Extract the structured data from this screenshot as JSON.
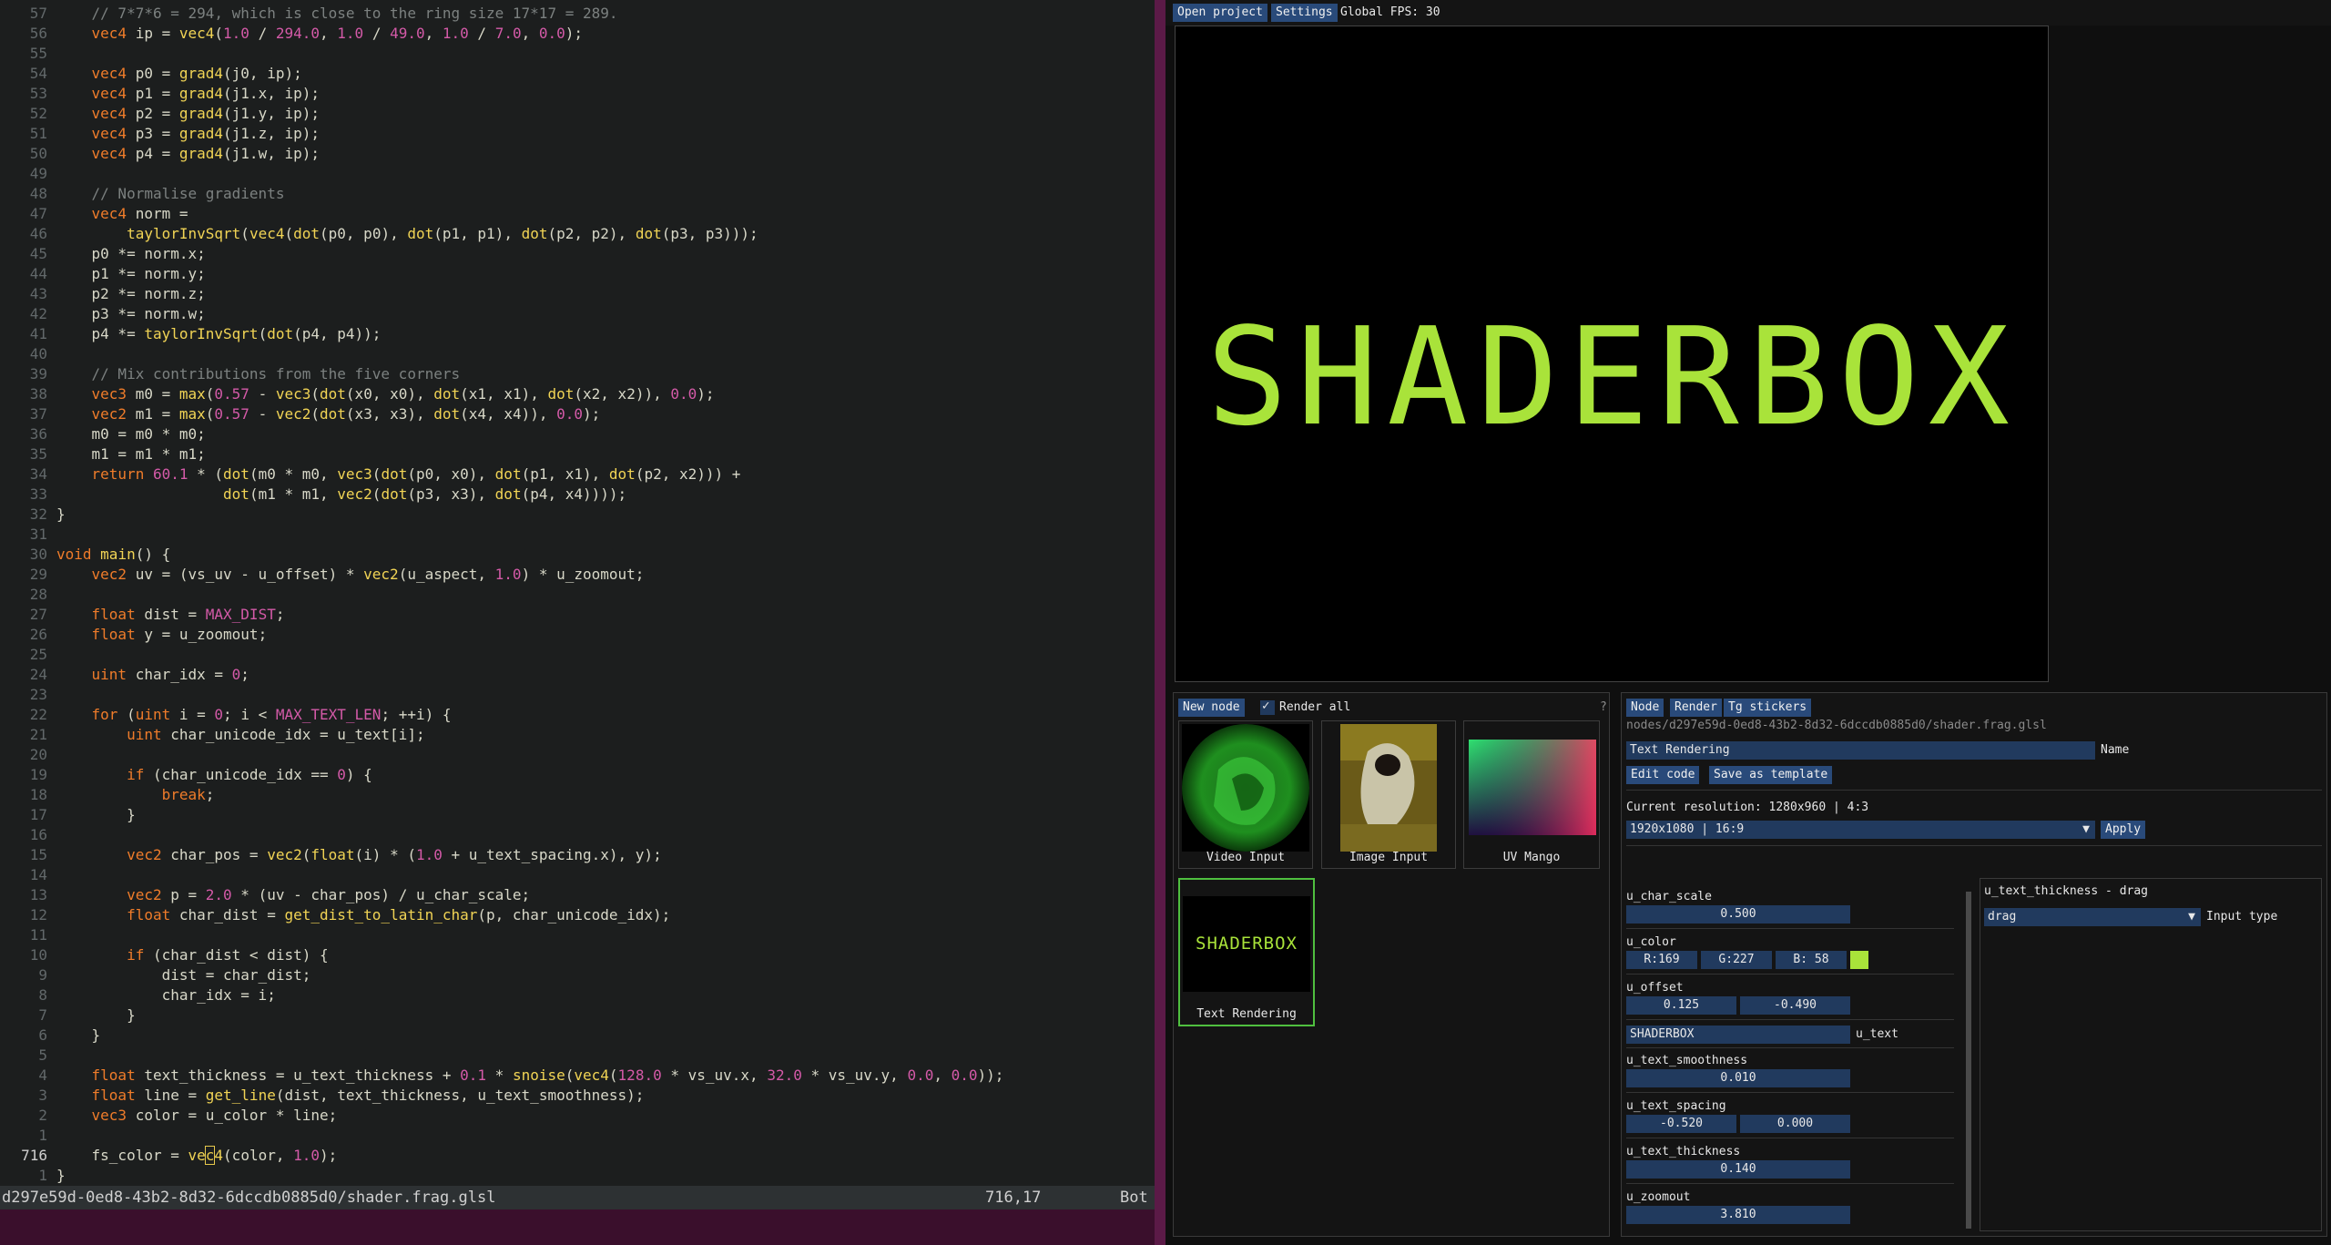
{
  "editor": {
    "status_path": "d297e59d-0ed8-43b2-8d32-6dccdb0885d0/shader.frag.glsl",
    "status_position": "716,17",
    "status_scroll": "Bot",
    "lines": [
      {
        "n": "57",
        "segs": [
          [
            "cm",
            "    // 7*7*6 = 294, which is close to the ring size 17*17 = 289."
          ]
        ]
      },
      {
        "n": "56",
        "segs": [
          [
            "kw",
            "    vec4"
          ],
          [
            "tx",
            " ip = "
          ],
          [
            "fn",
            "vec4"
          ],
          [
            "tx",
            "("
          ],
          [
            "nm",
            "1.0"
          ],
          [
            "tx",
            " / "
          ],
          [
            "nm",
            "294.0"
          ],
          [
            "tx",
            ", "
          ],
          [
            "nm",
            "1.0"
          ],
          [
            "tx",
            " / "
          ],
          [
            "nm",
            "49.0"
          ],
          [
            "tx",
            ", "
          ],
          [
            "nm",
            "1.0"
          ],
          [
            "tx",
            " / "
          ],
          [
            "nm",
            "7.0"
          ],
          [
            "tx",
            ", "
          ],
          [
            "nm",
            "0.0"
          ],
          [
            "tx",
            ");"
          ]
        ]
      },
      {
        "n": "55",
        "segs": []
      },
      {
        "n": "54",
        "segs": [
          [
            "kw",
            "    vec4"
          ],
          [
            "tx",
            " p0 = "
          ],
          [
            "fn",
            "grad4"
          ],
          [
            "tx",
            "(j0, ip);"
          ]
        ]
      },
      {
        "n": "53",
        "segs": [
          [
            "kw",
            "    vec4"
          ],
          [
            "tx",
            " p1 = "
          ],
          [
            "fn",
            "grad4"
          ],
          [
            "tx",
            "(j1.x, ip);"
          ]
        ]
      },
      {
        "n": "52",
        "segs": [
          [
            "kw",
            "    vec4"
          ],
          [
            "tx",
            " p2 = "
          ],
          [
            "fn",
            "grad4"
          ],
          [
            "tx",
            "(j1.y, ip);"
          ]
        ]
      },
      {
        "n": "51",
        "segs": [
          [
            "kw",
            "    vec4"
          ],
          [
            "tx",
            " p3 = "
          ],
          [
            "fn",
            "grad4"
          ],
          [
            "tx",
            "(j1.z, ip);"
          ]
        ]
      },
      {
        "n": "50",
        "segs": [
          [
            "kw",
            "    vec4"
          ],
          [
            "tx",
            " p4 = "
          ],
          [
            "fn",
            "grad4"
          ],
          [
            "tx",
            "(j1.w, ip);"
          ]
        ]
      },
      {
        "n": "49",
        "segs": []
      },
      {
        "n": "48",
        "segs": [
          [
            "cm",
            "    // Normalise gradients"
          ]
        ]
      },
      {
        "n": "47",
        "segs": [
          [
            "kw",
            "    vec4"
          ],
          [
            "tx",
            " norm ="
          ]
        ]
      },
      {
        "n": "46",
        "segs": [
          [
            "fn",
            "        taylorInvSqrt"
          ],
          [
            "tx",
            "("
          ],
          [
            "fn",
            "vec4"
          ],
          [
            "tx",
            "("
          ],
          [
            "fn",
            "dot"
          ],
          [
            "tx",
            "(p0, p0), "
          ],
          [
            "fn",
            "dot"
          ],
          [
            "tx",
            "(p1, p1), "
          ],
          [
            "fn",
            "dot"
          ],
          [
            "tx",
            "(p2, p2), "
          ],
          [
            "fn",
            "dot"
          ],
          [
            "tx",
            "(p3, p3)));"
          ]
        ]
      },
      {
        "n": "45",
        "segs": [
          [
            "tx",
            "    p0 *= norm.x;"
          ]
        ]
      },
      {
        "n": "44",
        "segs": [
          [
            "tx",
            "    p1 *= norm.y;"
          ]
        ]
      },
      {
        "n": "43",
        "segs": [
          [
            "tx",
            "    p2 *= norm.z;"
          ]
        ]
      },
      {
        "n": "42",
        "segs": [
          [
            "tx",
            "    p3 *= norm.w;"
          ]
        ]
      },
      {
        "n": "41",
        "segs": [
          [
            "tx",
            "    p4 *= "
          ],
          [
            "fn",
            "taylorInvSqrt"
          ],
          [
            "tx",
            "("
          ],
          [
            "fn",
            "dot"
          ],
          [
            "tx",
            "(p4, p4));"
          ]
        ]
      },
      {
        "n": "40",
        "segs": []
      },
      {
        "n": "39",
        "segs": [
          [
            "cm",
            "    // Mix contributions from the five corners"
          ]
        ]
      },
      {
        "n": "38",
        "segs": [
          [
            "kw",
            "    vec3"
          ],
          [
            "tx",
            " m0 = "
          ],
          [
            "fn",
            "max"
          ],
          [
            "tx",
            "("
          ],
          [
            "nm",
            "0.57"
          ],
          [
            "tx",
            " - "
          ],
          [
            "fn",
            "vec3"
          ],
          [
            "tx",
            "("
          ],
          [
            "fn",
            "dot"
          ],
          [
            "tx",
            "(x0, x0), "
          ],
          [
            "fn",
            "dot"
          ],
          [
            "tx",
            "(x1, x1), "
          ],
          [
            "fn",
            "dot"
          ],
          [
            "tx",
            "(x2, x2)), "
          ],
          [
            "nm",
            "0.0"
          ],
          [
            "tx",
            ");"
          ]
        ]
      },
      {
        "n": "37",
        "segs": [
          [
            "kw",
            "    vec2"
          ],
          [
            "tx",
            " m1 = "
          ],
          [
            "fn",
            "max"
          ],
          [
            "tx",
            "("
          ],
          [
            "nm",
            "0.57"
          ],
          [
            "tx",
            " - "
          ],
          [
            "fn",
            "vec2"
          ],
          [
            "tx",
            "("
          ],
          [
            "fn",
            "dot"
          ],
          [
            "tx",
            "(x3, x3), "
          ],
          [
            "fn",
            "dot"
          ],
          [
            "tx",
            "(x4, x4)), "
          ],
          [
            "nm",
            "0.0"
          ],
          [
            "tx",
            ");"
          ]
        ]
      },
      {
        "n": "36",
        "segs": [
          [
            "tx",
            "    m0 = m0 * m0;"
          ]
        ]
      },
      {
        "n": "35",
        "segs": [
          [
            "tx",
            "    m1 = m1 * m1;"
          ]
        ]
      },
      {
        "n": "34",
        "segs": [
          [
            "kw",
            "    return"
          ],
          [
            "tx",
            " "
          ],
          [
            "nm",
            "60.1"
          ],
          [
            "tx",
            " * ("
          ],
          [
            "fn",
            "dot"
          ],
          [
            "tx",
            "(m0 * m0, "
          ],
          [
            "fn",
            "vec3"
          ],
          [
            "tx",
            "("
          ],
          [
            "fn",
            "dot"
          ],
          [
            "tx",
            "(p0, x0), "
          ],
          [
            "fn",
            "dot"
          ],
          [
            "tx",
            "(p1, x1), "
          ],
          [
            "fn",
            "dot"
          ],
          [
            "tx",
            "(p2, x2))) +"
          ]
        ]
      },
      {
        "n": "33",
        "segs": [
          [
            "tx",
            "                   "
          ],
          [
            "fn",
            "dot"
          ],
          [
            "tx",
            "(m1 * m1, "
          ],
          [
            "fn",
            "vec2"
          ],
          [
            "tx",
            "("
          ],
          [
            "fn",
            "dot"
          ],
          [
            "tx",
            "(p3, x3), "
          ],
          [
            "fn",
            "dot"
          ],
          [
            "tx",
            "(p4, x4))));"
          ]
        ]
      },
      {
        "n": "32",
        "segs": [
          [
            "tx",
            "}"
          ]
        ]
      },
      {
        "n": "31",
        "segs": []
      },
      {
        "n": "30",
        "segs": [
          [
            "kw",
            "void"
          ],
          [
            "tx",
            " "
          ],
          [
            "fn",
            "main"
          ],
          [
            "tx",
            "() {"
          ]
        ]
      },
      {
        "n": "29",
        "segs": [
          [
            "kw",
            "    vec2"
          ],
          [
            "tx",
            " uv = (vs_uv - u_offset) * "
          ],
          [
            "fn",
            "vec2"
          ],
          [
            "tx",
            "(u_aspect, "
          ],
          [
            "nm",
            "1.0"
          ],
          [
            "tx",
            ") * u_zoomout;"
          ]
        ]
      },
      {
        "n": "28",
        "segs": []
      },
      {
        "n": "27",
        "segs": [
          [
            "kw",
            "    float"
          ],
          [
            "tx",
            " dist = "
          ],
          [
            "mc",
            "MAX_DIST"
          ],
          [
            "tx",
            ";"
          ]
        ]
      },
      {
        "n": "26",
        "segs": [
          [
            "kw",
            "    float"
          ],
          [
            "tx",
            " y = u_zoomout;"
          ]
        ]
      },
      {
        "n": "25",
        "segs": []
      },
      {
        "n": "24",
        "segs": [
          [
            "kw",
            "    uint"
          ],
          [
            "tx",
            " char_idx = "
          ],
          [
            "nm",
            "0"
          ],
          [
            "tx",
            ";"
          ]
        ]
      },
      {
        "n": "23",
        "segs": []
      },
      {
        "n": "22",
        "segs": [
          [
            "kw",
            "    for"
          ],
          [
            "tx",
            " ("
          ],
          [
            "kw",
            "uint"
          ],
          [
            "tx",
            " i = "
          ],
          [
            "nm",
            "0"
          ],
          [
            "tx",
            "; i < "
          ],
          [
            "mc",
            "MAX_TEXT_LEN"
          ],
          [
            "tx",
            "; ++i) {"
          ]
        ]
      },
      {
        "n": "21",
        "segs": [
          [
            "kw",
            "        uint"
          ],
          [
            "tx",
            " char_unicode_idx = u_text[i];"
          ]
        ]
      },
      {
        "n": "20",
        "segs": []
      },
      {
        "n": "19",
        "segs": [
          [
            "kw",
            "        if"
          ],
          [
            "tx",
            " (char_unicode_idx == "
          ],
          [
            "nm",
            "0"
          ],
          [
            "tx",
            ") {"
          ]
        ]
      },
      {
        "n": "18",
        "segs": [
          [
            "kw",
            "            break"
          ],
          [
            "tx",
            ";"
          ]
        ]
      },
      {
        "n": "17",
        "segs": [
          [
            "tx",
            "        }"
          ]
        ]
      },
      {
        "n": "16",
        "segs": []
      },
      {
        "n": "15",
        "segs": [
          [
            "kw",
            "        vec2"
          ],
          [
            "tx",
            " char_pos = "
          ],
          [
            "fn",
            "vec2"
          ],
          [
            "tx",
            "("
          ],
          [
            "fn",
            "float"
          ],
          [
            "tx",
            "(i) * ("
          ],
          [
            "nm",
            "1.0"
          ],
          [
            "tx",
            " + u_text_spacing.x), y);"
          ]
        ]
      },
      {
        "n": "14",
        "segs": []
      },
      {
        "n": "13",
        "segs": [
          [
            "kw",
            "        vec2"
          ],
          [
            "tx",
            " p = "
          ],
          [
            "nm",
            "2.0"
          ],
          [
            "tx",
            " * (uv - char_pos) / u_char_scale;"
          ]
        ]
      },
      {
        "n": "12",
        "segs": [
          [
            "kw",
            "        float"
          ],
          [
            "tx",
            " char_dist = "
          ],
          [
            "fn",
            "get_dist_to_latin_char"
          ],
          [
            "tx",
            "(p, char_unicode_idx);"
          ]
        ]
      },
      {
        "n": "11",
        "segs": []
      },
      {
        "n": "10",
        "segs": [
          [
            "kw",
            "        if"
          ],
          [
            "tx",
            " (char_dist < dist) {"
          ]
        ]
      },
      {
        "n": "9",
        "segs": [
          [
            "tx",
            "            dist = char_dist;"
          ]
        ]
      },
      {
        "n": "8",
        "segs": [
          [
            "tx",
            "            char_idx = i;"
          ]
        ]
      },
      {
        "n": "7",
        "segs": [
          [
            "tx",
            "        }"
          ]
        ]
      },
      {
        "n": "6",
        "segs": [
          [
            "tx",
            "    }"
          ]
        ]
      },
      {
        "n": "5",
        "segs": []
      },
      {
        "n": "4",
        "segs": [
          [
            "kw",
            "    float"
          ],
          [
            "tx",
            " text_thickness = u_text_thickness + "
          ],
          [
            "nm",
            "0.1"
          ],
          [
            "tx",
            " * "
          ],
          [
            "fn",
            "snoise"
          ],
          [
            "tx",
            "("
          ],
          [
            "fn",
            "vec4"
          ],
          [
            "tx",
            "("
          ],
          [
            "nm",
            "128.0"
          ],
          [
            "tx",
            " * vs_uv.x, "
          ],
          [
            "nm",
            "32.0"
          ],
          [
            "tx",
            " * vs_uv.y, "
          ],
          [
            "nm",
            "0.0"
          ],
          [
            "tx",
            ", "
          ],
          [
            "nm",
            "0.0"
          ],
          [
            "tx",
            "));"
          ]
        ]
      },
      {
        "n": "3",
        "segs": [
          [
            "kw",
            "    float"
          ],
          [
            "tx",
            " line = "
          ],
          [
            "fn",
            "get_line"
          ],
          [
            "tx",
            "(dist, text_thickness, u_text_smoothness);"
          ]
        ]
      },
      {
        "n": "2",
        "segs": [
          [
            "kw",
            "    vec3"
          ],
          [
            "tx",
            " color = u_color * line;"
          ]
        ]
      },
      {
        "n": "1",
        "segs": []
      },
      {
        "n": "716",
        "cur": true,
        "segs": [
          [
            "tx",
            "    fs_color = "
          ],
          [
            "fn",
            "ve"
          ],
          [
            "cur",
            "c"
          ],
          [
            "fn",
            "4"
          ],
          [
            "tx",
            "(color, "
          ],
          [
            "nm",
            "1.0"
          ],
          [
            "tx",
            ");"
          ]
        ]
      },
      {
        "n": "1",
        "segs": [
          [
            "tx",
            "}"
          ]
        ]
      }
    ]
  },
  "menu": {
    "open_project": "Open project",
    "settings": "Settings",
    "fps": "Global FPS: 30"
  },
  "preview": {
    "text": "SHADERBOX",
    "text_color": "#a9e33a"
  },
  "nodes_panel": {
    "new_node": "New node",
    "render_all": "Render all",
    "help": "?",
    "nodes": [
      {
        "label": "Video Input"
      },
      {
        "label": "Image Input"
      },
      {
        "label": "UV Mango"
      },
      {
        "label": "Text Rendering",
        "preview_text": "SHADERBOX"
      }
    ]
  },
  "inspector": {
    "tabs": {
      "node": "Node",
      "render": "Render",
      "tg": "Tg stickers"
    },
    "path": "nodes/d297e59d-0ed8-43b2-8d32-6dccdb0885d0/shader.frag.glsl",
    "name_value": "Text Rendering",
    "name_label": "Name",
    "edit_code": "Edit code",
    "save_template": "Save as template",
    "current_resolution": "Current resolution: 1280x960 | 4:3",
    "resolution_select": "1920x1080 | 16:9",
    "apply": "Apply",
    "uniforms": {
      "char_scale": {
        "name": "u_char_scale",
        "value": "0.500"
      },
      "color": {
        "name": "u_color",
        "r": "R:169",
        "g": "G:227",
        "b": "B: 58",
        "swatch": "#a9e33a"
      },
      "offset": {
        "name": "u_offset",
        "x": "0.125",
        "y": "-0.490"
      },
      "text": {
        "value": "SHADERBOX",
        "name": "u_text"
      },
      "smoothness": {
        "name": "u_text_smoothness",
        "value": "0.010"
      },
      "spacing": {
        "name": "u_text_spacing",
        "x": "-0.520",
        "y": "0.000"
      },
      "thickness": {
        "name": "u_text_thickness",
        "value": "0.140"
      },
      "zoomout": {
        "name": "u_zoomout",
        "value": "3.810"
      }
    },
    "detail": {
      "title": "u_text_thickness - drag",
      "select": "drag",
      "label": "Input type"
    }
  }
}
